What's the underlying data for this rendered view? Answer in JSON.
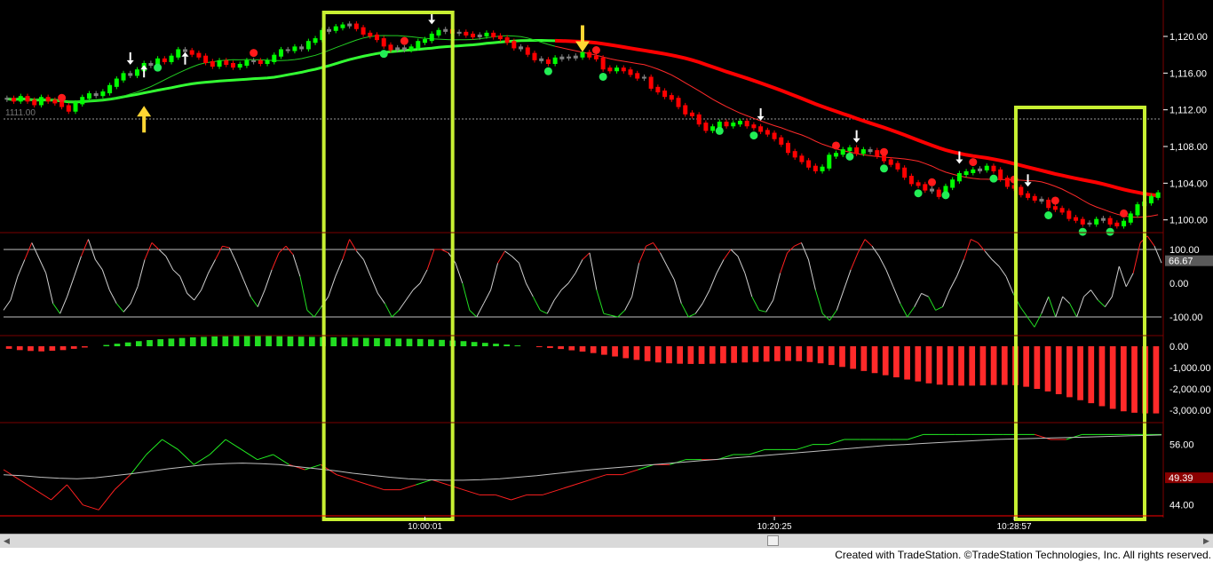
{
  "chart_data": [
    {
      "type": "line",
      "title": "",
      "panel": "price",
      "ylim": [
        1099,
        1123
      ],
      "y_ticks": [
        "1,120.00",
        "1,116.00",
        "1,112.00",
        "1,108.00",
        "1,104.00",
        "1,100.00"
      ],
      "y_tick_values": [
        1120,
        1116,
        1112,
        1108,
        1104,
        1100
      ],
      "reference_label": "1111.00",
      "reference_value": 1111,
      "x_ticks": [
        "10:00:01",
        "10:20:25",
        "10:28:57"
      ],
      "x_tick_index": [
        61,
        112,
        147
      ],
      "bars": 165,
      "closes": [
        1113.2,
        1113.0,
        1113.4,
        1113.0,
        1112.6,
        1113.3,
        1113.0,
        1112.8,
        1112.4,
        1111.9,
        1112.7,
        1113.3,
        1113.7,
        1113.6,
        1113.9,
        1114.6,
        1115.3,
        1115.9,
        1115.8,
        1116.3,
        1117.0,
        1116.9,
        1117.5,
        1117.3,
        1117.8,
        1118.5,
        1118.4,
        1118.1,
        1117.8,
        1117.2,
        1116.8,
        1117.3,
        1117.0,
        1116.7,
        1116.9,
        1117.3,
        1117.3,
        1117.1,
        1117.3,
        1117.9,
        1118.5,
        1118.5,
        1118.8,
        1118.7,
        1119.4,
        1119.7,
        1120.6,
        1120.7,
        1121.0,
        1121.2,
        1121.3,
        1120.9,
        1120.3,
        1120.1,
        1119.7,
        1119.0,
        1118.6,
        1118.7,
        1118.6,
        1118.8,
        1119.4,
        1119.6,
        1120.2,
        1120.6,
        1120.7,
        1120.4,
        1120.4,
        1120.2,
        1120.0,
        1120.1,
        1120.3,
        1120.0,
        1119.8,
        1119.4,
        1118.8,
        1118.7,
        1118.1,
        1117.5,
        1117.4,
        1117.1,
        1117.6,
        1117.7,
        1117.7,
        1117.8,
        1118.2,
        1117.8,
        1117.6,
        1116.5,
        1116.3,
        1116.5,
        1116.3,
        1115.9,
        1115.5,
        1115.5,
        1114.4,
        1114.0,
        1113.5,
        1113.2,
        1112.4,
        1111.6,
        1111.4,
        1110.5,
        1109.8,
        1110.1,
        1110.6,
        1110.3,
        1110.5,
        1110.7,
        1110.3,
        1110.1,
        1109.7,
        1109.4,
        1108.9,
        1108.3,
        1107.4,
        1106.9,
        1106.4,
        1105.8,
        1105.4,
        1105.7,
        1107.0,
        1107.2,
        1107.6,
        1107.8,
        1107.3,
        1107.6,
        1107.5,
        1107.0,
        1106.5,
        1106.1,
        1105.6,
        1104.7,
        1104.0,
        1103.8,
        1103.3,
        1103.2,
        1102.6,
        1103.6,
        1104.3,
        1105.0,
        1105.2,
        1105.4,
        1105.5,
        1105.8,
        1105.4,
        1104.5,
        1103.7,
        1103.5,
        1102.8,
        1102.5,
        1102.2,
        1102.1,
        1101.4,
        1101.2,
        1100.9,
        1100.2,
        1100.0,
        1099.6,
        1099.6,
        1100.0,
        1100.1,
        1099.6,
        1099.4,
        1099.8,
        1100.6,
        1101.6,
        1101.9,
        1102.5,
        1102.9
      ],
      "ma_short_last": 1103.3,
      "ma_long_last": 1106.8,
      "dots_red_index": [
        8,
        36,
        58,
        86,
        121,
        128,
        135,
        141,
        147,
        153,
        163
      ],
      "dots_green_index": [
        22,
        55,
        79,
        87,
        104,
        109,
        123,
        128,
        133,
        137,
        144,
        152,
        157,
        161
      ],
      "arrows_down_index": [
        18,
        150,
        156,
        182,
        238,
        269,
        310
      ],
      "arrows_up_index": [
        43,
        60
      ],
      "highlight_boxes_x_index": [
        [
          47,
          64
        ],
        [
          148,
          165
        ]
      ],
      "yellow_arrows": [
        "up",
        "down"
      ]
    },
    {
      "type": "line",
      "panel": "oscillator",
      "ylim": [
        -150,
        150
      ],
      "y_ticks": [
        "100.00",
        "0.00",
        "-100.00"
      ],
      "y_tick_values": [
        100,
        0,
        -100
      ],
      "current_value_label": "66.67",
      "current_value": 66.67,
      "reference_lines": [
        100,
        -100
      ],
      "series": [
        {
          "values": [
            -80,
            -50,
            20,
            70,
            120,
            75,
            30,
            -60,
            -90,
            -40,
            20,
            80,
            130,
            70,
            40,
            -20,
            -60,
            -85,
            -60,
            -10,
            70,
            120,
            100,
            80,
            40,
            20,
            -30,
            -50,
            -20,
            30,
            70,
            110,
            105,
            60,
            10,
            -40,
            -70,
            -20,
            40,
            90,
            110,
            85,
            20,
            -80,
            -100,
            -70,
            -40,
            20,
            70,
            130,
            95,
            70,
            20,
            -30,
            -60,
            -100,
            -80,
            -50,
            -20,
            0,
            40,
            100,
            100,
            90,
            60,
            0,
            -80,
            -100,
            -60,
            -20,
            60,
            95,
            80,
            60,
            0,
            -40,
            -80,
            -90,
            -50,
            -20,
            0,
            30,
            70,
            90,
            -20,
            -90,
            -95,
            -100,
            -80,
            -40,
            60,
            110,
            120,
            90,
            50,
            10,
            -60,
            -100,
            -90,
            -60,
            -20,
            30,
            70,
            100,
            80,
            30,
            -40,
            -80,
            -85,
            -50,
            30,
            90,
            110,
            120,
            70,
            -20,
            -90,
            -110,
            -80,
            -20,
            40,
            90,
            130,
            110,
            80,
            40,
            -10,
            -60,
            -100,
            -70,
            -30,
            -40,
            -80,
            -70,
            -20,
            20,
            70,
            130,
            120,
            95,
            70,
            50,
            20,
            -30,
            -70,
            -100,
            -130,
            -90,
            -40,
            -100,
            -40,
            -60,
            -100,
            -40,
            -20,
            -50,
            -70,
            -40,
            50,
            -10,
            30,
            120,
            140,
            110,
            60
          ]
        }
      ]
    },
    {
      "type": "bar",
      "panel": "histogram",
      "ylim": [
        -3500,
        500
      ],
      "y_ticks": [
        "0.00",
        "-1,000.00",
        "-2,000.00",
        "-3,000.00"
      ],
      "y_tick_values": [
        0,
        -1000,
        -2000,
        -3000
      ],
      "series": [
        {
          "values": [
            -120,
            -180,
            -220,
            -240,
            -210,
            -180,
            -120,
            -60,
            0,
            60,
            120,
            180,
            240,
            290,
            330,
            360,
            390,
            420,
            440,
            460,
            470,
            480,
            490,
            490,
            480,
            470,
            460,
            450,
            440,
            430,
            420,
            410,
            400,
            390,
            380,
            370,
            360,
            350,
            340,
            320,
            300,
            270,
            240,
            200,
            160,
            120,
            80,
            40,
            0,
            -40,
            -80,
            -130,
            -190,
            -250,
            -320,
            -400,
            -480,
            -560,
            -640,
            -700,
            -760,
            -800,
            -820,
            -830,
            -830,
            -820,
            -800,
            -780,
            -760,
            -740,
            -720,
            -700,
            -690,
            -700,
            -740,
            -800,
            -880,
            -970,
            -1060,
            -1160,
            -1260,
            -1360,
            -1460,
            -1560,
            -1650,
            -1740,
            -1800,
            -1830,
            -1850,
            -1850,
            -1840,
            -1820,
            -1810,
            -1830,
            -1900,
            -2000,
            -2120,
            -2250,
            -2390,
            -2530,
            -2670,
            -2810,
            -2940,
            -3050,
            -3120,
            -3150,
            -3150
          ]
        }
      ]
    },
    {
      "type": "line",
      "panel": "lower",
      "ylim": [
        42,
        60
      ],
      "y_ticks": [
        "56.00",
        "44.00"
      ],
      "y_tick_values": [
        56,
        44
      ],
      "current_value_label": "49.39",
      "current_value": 49.39,
      "series": [
        {
          "values": [
            51,
            49,
            47,
            45,
            48,
            44,
            43,
            47,
            50,
            54,
            57,
            55,
            52,
            54,
            57,
            55,
            53,
            54,
            52,
            51,
            52,
            50,
            49,
            48,
            47,
            47,
            48,
            49,
            48,
            47,
            46,
            46,
            45,
            46,
            46,
            47,
            48,
            49,
            50,
            50,
            51,
            52,
            52,
            53,
            53,
            53,
            54,
            54,
            55,
            55,
            55,
            56,
            56,
            57,
            57,
            57,
            57,
            57,
            58,
            58,
            58,
            58,
            58,
            58,
            58,
            58,
            57,
            57,
            58,
            58,
            58,
            58,
            58,
            58
          ]
        },
        {
          "values": [
            50,
            49.8,
            49.5,
            49.3,
            49.2,
            49.4,
            49.8,
            50.2,
            50.7,
            51.2,
            51.6,
            52.0,
            52.2,
            52.3,
            52.2,
            52.0,
            51.6,
            51.2,
            50.8,
            50.3,
            49.9,
            49.5,
            49.2,
            49.0,
            48.9,
            48.9,
            49.0,
            49.2,
            49.5,
            49.8,
            50.2,
            50.6,
            51.0,
            51.3,
            51.6,
            51.9,
            52.2,
            52.5,
            52.8,
            53.1,
            53.4,
            53.7,
            54.0,
            54.3,
            54.6,
            54.9,
            55.2,
            55.5,
            55.8,
            56.0,
            56.2,
            56.4,
            56.6,
            56.8,
            57.0,
            57.1,
            57.2,
            57.3,
            57.4,
            57.5,
            57.6,
            57.7,
            57.8,
            57.9
          ]
        }
      ]
    }
  ],
  "credit_text": "Created with TradeStation. ©TradeStation Technologies, Inc. All rights reserved.",
  "colors": {
    "background": "#000000",
    "up_bar": "#00ff00",
    "down_bar": "#ff0000",
    "neutral_bar": "#7f7f7f",
    "ma_long": "#ff0000",
    "ma_short": "#ff2a2a",
    "ma_green": "#33ff33",
    "highlight_box": "#c8f032",
    "yellow_arrow": "#ffd633",
    "panel_divider": "#7a0000"
  }
}
